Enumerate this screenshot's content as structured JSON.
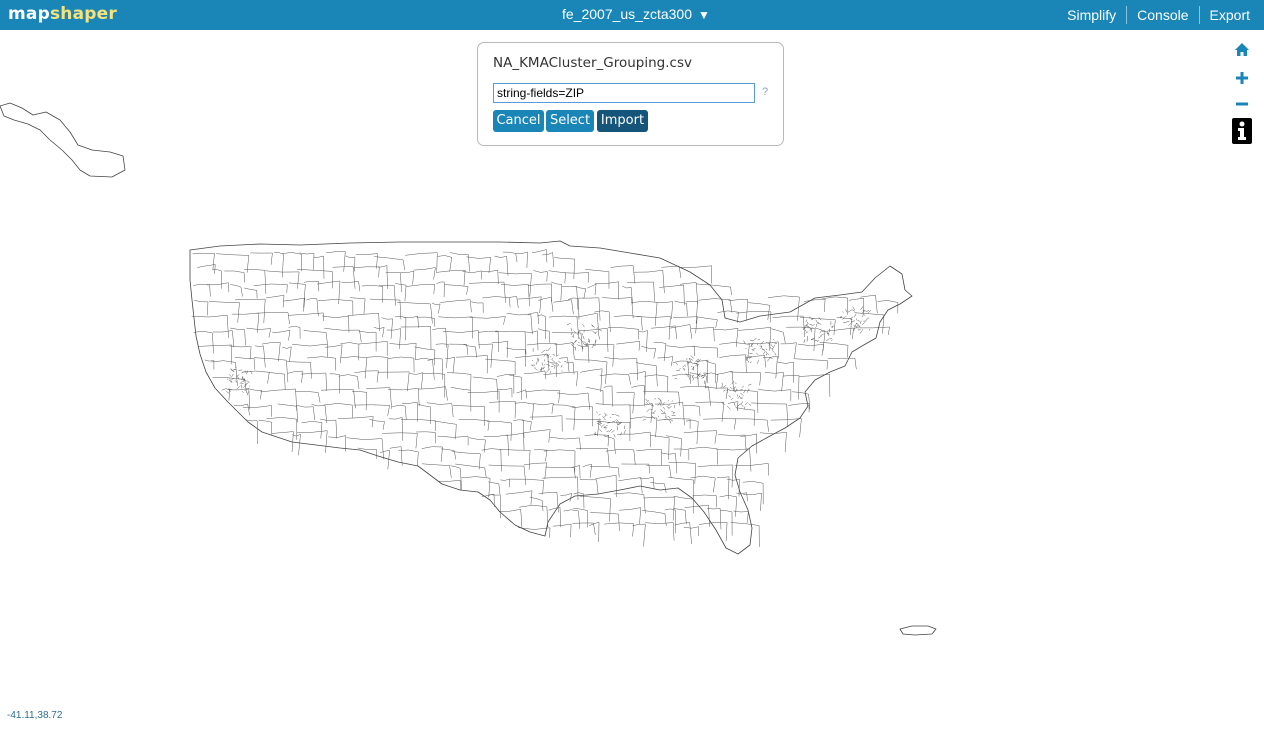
{
  "app": {
    "logo_part1": "map",
    "logo_part2": "shaper"
  },
  "header": {
    "layer_name": "fe_2007_us_zcta300",
    "layer_caret": "▼",
    "menu": [
      {
        "label": "Simplify"
      },
      {
        "label": "Console"
      },
      {
        "label": "Export"
      }
    ]
  },
  "import_dialog": {
    "title": "NA_KMACluster_Grouping.csv",
    "options_value": "string-fields=ZIP",
    "help_label": "?",
    "buttons": {
      "cancel": "Cancel",
      "select": "Select",
      "import": "Import"
    }
  },
  "map_tools": [
    "home-icon",
    "zoom-in-icon",
    "zoom-out-icon",
    "info-icon"
  ],
  "status": {
    "coordinates": "-41.11,38.72"
  },
  "colors": {
    "header_bg": "#1a86b8",
    "logo_accent": "#f5e27a",
    "button": "#1a86b8",
    "button_primary": "#15557a",
    "map_stroke": "#444444"
  }
}
